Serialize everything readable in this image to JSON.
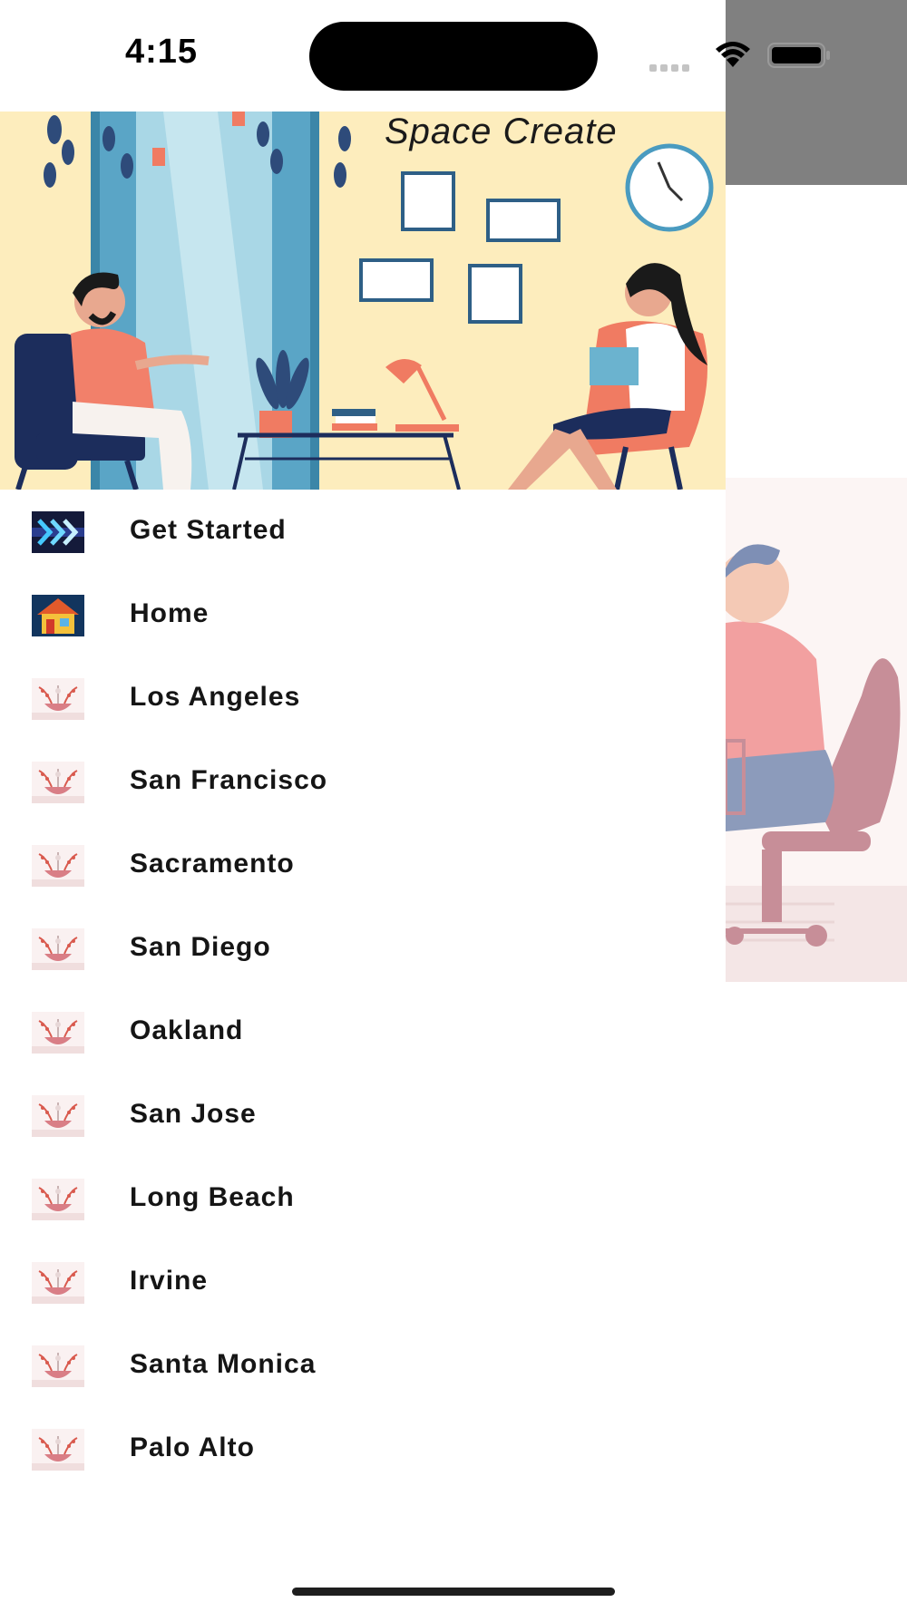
{
  "status_bar": {
    "time": "4:15"
  },
  "drawer": {
    "header": {
      "title": "Space Create",
      "background_color": "#fdedbd"
    },
    "items": [
      {
        "label": "Get Started",
        "icon": "arrows-icon"
      },
      {
        "label": "Home",
        "icon": "house-icon"
      },
      {
        "label": "Los Angeles",
        "icon": "plant-bowl-icon"
      },
      {
        "label": "San Francisco",
        "icon": "plant-bowl-icon"
      },
      {
        "label": "Sacramento",
        "icon": "plant-bowl-icon"
      },
      {
        "label": "San Diego",
        "icon": "plant-bowl-icon"
      },
      {
        "label": "Oakland",
        "icon": "plant-bowl-icon"
      },
      {
        "label": "San Jose",
        "icon": "plant-bowl-icon"
      },
      {
        "label": "Long Beach",
        "icon": "plant-bowl-icon"
      },
      {
        "label": "Irvine",
        "icon": "plant-bowl-icon"
      },
      {
        "label": "Santa Monica",
        "icon": "plant-bowl-icon"
      },
      {
        "label": "Palo Alto",
        "icon": "plant-bowl-icon"
      }
    ]
  },
  "colors": {
    "overlay_gray": "#808080",
    "text": "#151515"
  }
}
